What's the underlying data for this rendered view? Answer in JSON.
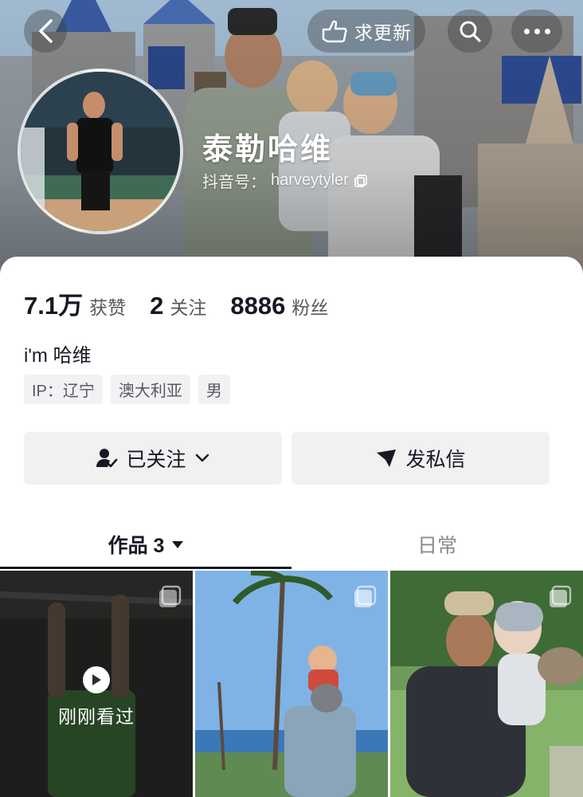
{
  "header": {
    "update_label": "求更新",
    "icons": {
      "back": "chevron-left-icon",
      "update": "hand-point-icon",
      "search": "search-icon",
      "more": "more-dots-icon"
    }
  },
  "profile": {
    "name": "泰勒哈维",
    "douyin_id_label": "抖音号：",
    "douyin_id": "harveytyler",
    "stats": [
      {
        "value": "7.1万",
        "label": "获赞"
      },
      {
        "value": "2",
        "label": "关注"
      },
      {
        "value": "8886",
        "label": "粉丝"
      }
    ],
    "bio": "i'm 哈维",
    "tags": [
      "IP：辽宁",
      "澳大利亚",
      "男"
    ]
  },
  "actions": {
    "following_label": "已关注",
    "message_label": "发私信"
  },
  "tabs": [
    {
      "label": "作品 3",
      "active": true
    },
    {
      "label": "日常",
      "active": false
    }
  ],
  "videos": [
    {
      "overlay": "刚刚看过"
    },
    {
      "overlay": ""
    },
    {
      "overlay": ""
    }
  ],
  "colors": {
    "primary_text": "#161823",
    "secondary_text": "#57585f",
    "button_bg": "#f1f1f2"
  }
}
